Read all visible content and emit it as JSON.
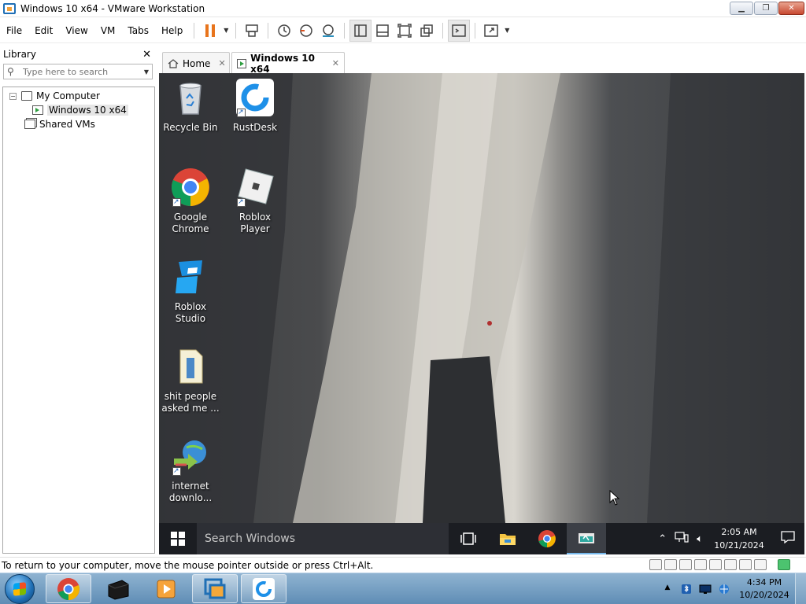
{
  "window": {
    "title": "Windows 10 x64 - VMware Workstation",
    "controls": {
      "minimize": "▁",
      "restore": "❐",
      "close": "✕"
    }
  },
  "menu": [
    "File",
    "Edit",
    "View",
    "VM",
    "Tabs",
    "Help"
  ],
  "library": {
    "title": "Library",
    "close_label": "✕",
    "search_placeholder": "Type here to search",
    "tree": {
      "my_computer": "My Computer",
      "expander": "−",
      "vm": "Windows 10 x64",
      "shared": "Shared VMs"
    }
  },
  "tabs": [
    {
      "label": "Home",
      "close": "✕"
    },
    {
      "label": "Windows 10 x64",
      "close": "✕"
    }
  ],
  "guest": {
    "desktop_icons": [
      {
        "label": "Recycle Bin"
      },
      {
        "label": "RustDesk"
      },
      {
        "label": "Google Chrome"
      },
      {
        "label": "Roblox Player"
      },
      {
        "label": "Roblox Studio"
      },
      {
        "label": "shit people asked me ..."
      },
      {
        "label": "internet downlo..."
      }
    ],
    "taskbar": {
      "search_placeholder": "Search Windows",
      "time": "2:05 AM",
      "date": "10/21/2024"
    }
  },
  "status": {
    "message": "To return to your computer, move the mouse pointer outside or press Ctrl+Alt."
  },
  "host": {
    "time": "4:34 PM",
    "date": "10/20/2024"
  },
  "colors": {
    "accent": "#1f6fb5",
    "pause_orange": "#e8741c",
    "guest_taskbar": "#1b1d22"
  }
}
